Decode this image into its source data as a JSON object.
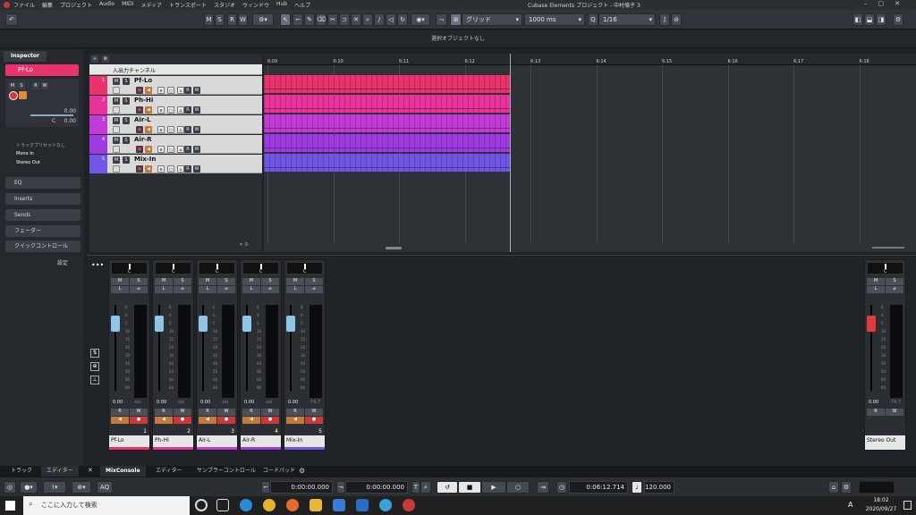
{
  "menu": [
    "ファイル",
    "編集",
    "プロジェクト",
    "Audio",
    "MIDI",
    "メディア",
    "トランスポート",
    "スタジオ",
    "ウィンドウ",
    "Hub",
    "ヘルプ"
  ],
  "window_title": "Cubase Elements プロジェクト - 中村倫子 3",
  "toolbar": {
    "m": "M",
    "s": "S",
    "r": "R",
    "w": "W",
    "grid_label": "グリッド",
    "quantize": "1000 ms",
    "snap": "1/16"
  },
  "infobar_text": "選択オブジェクトなし",
  "inspector": {
    "tab": "Inspector",
    "track_name": "Pf-Lo",
    "vol_value": "0.00",
    "pan_value": "C",
    "pan_value2": "0.00",
    "preset": "トラックプリセットなし",
    "input": "Mono In",
    "output": "Stereo Out",
    "sections": [
      "EQ",
      "Inserts",
      "Sends",
      "フェーダー",
      "クイックコントロール"
    ],
    "settings": "設定"
  },
  "tracklist_header": "入出力チャンネル",
  "tracks": [
    {
      "num": "1",
      "name": "Pf-Lo",
      "color": "#e8336d"
    },
    {
      "num": "2",
      "name": "Ph-Hi",
      "color": "#e8339a"
    },
    {
      "num": "3",
      "name": "Air-L",
      "color": "#c23bd6"
    },
    {
      "num": "4",
      "name": "Air-R",
      "color": "#9d3be0"
    },
    {
      "num": "5",
      "name": "Mix-In",
      "color": "#7055e6"
    }
  ],
  "ruler": [
    "6:09",
    "6:10",
    "6:11",
    "6:12",
    "6:13",
    "6:14",
    "6:15",
    "6:16",
    "6:17",
    "6:18"
  ],
  "mixer": {
    "strips": [
      {
        "name": "Pf-Lo",
        "num": "1",
        "value": "0.00",
        "peak": "-oo",
        "color": "#e8336d"
      },
      {
        "name": "Ph-Hi",
        "num": "2",
        "value": "0.00",
        "peak": "-oo",
        "color": "#e8339a"
      },
      {
        "name": "Air-L",
        "num": "3",
        "value": "0.00",
        "peak": "-oo",
        "color": "#c23bd6"
      },
      {
        "name": "Air-R",
        "num": "4",
        "value": "0.00",
        "peak": "-oo",
        "color": "#9d3be0"
      },
      {
        "name": "Mix-In",
        "num": "5",
        "value": "0.00",
        "peak": "-74.7",
        "color": "#7055e6"
      }
    ],
    "out": {
      "name": "Stereo Out",
      "value": "0.00",
      "peak": "-74.7"
    },
    "scale": [
      "6",
      "0",
      "5",
      "10",
      "15",
      "20",
      "30",
      "40",
      "50",
      "60",
      "80"
    ]
  },
  "lower_tabs": [
    "トラック",
    "エディター",
    "MixConsole",
    "エディター",
    "サンプラーコントロール",
    "コードパッド"
  ],
  "transport": {
    "left": "0:00:00.000",
    "right": "0:00:00.000",
    "position": "0:06:12.714",
    "tempo": "120.000",
    "aq": "AQ"
  },
  "taskbar": {
    "search": "ここに入力して検索",
    "time": "18:02",
    "date": "2020/09/27",
    "ime": "A"
  }
}
